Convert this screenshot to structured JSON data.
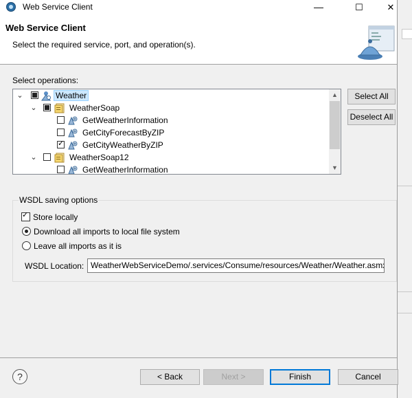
{
  "window": {
    "title": "Web Service Client",
    "minimize": "—",
    "maximize": "☐",
    "close": "✕"
  },
  "header": {
    "title": "Web Service Client",
    "description": "Select the required service, port, and operation(s)."
  },
  "operations": {
    "label": "Select operations:",
    "tree": [
      {
        "label": "Weather",
        "state": "partial",
        "expander": "⌄",
        "icon": "service-icon"
      },
      {
        "label": "WeatherSoap",
        "state": "partial",
        "expander": "⌄",
        "icon": "port-icon"
      },
      {
        "label": "GetWeatherInformation",
        "state": "unchecked",
        "icon": "operation-icon"
      },
      {
        "label": "GetCityForecastByZIP",
        "state": "unchecked",
        "icon": "operation-icon"
      },
      {
        "label": "GetCityWeatherByZIP",
        "state": "checked",
        "icon": "operation-icon"
      },
      {
        "label": "WeatherSoap12",
        "state": "unchecked",
        "expander": "⌄",
        "icon": "port-icon"
      },
      {
        "label": "GetWeatherInformation",
        "state": "unchecked",
        "icon": "operation-icon"
      }
    ],
    "select_all": "Select All",
    "deselect_all": "Deselect All"
  },
  "wsdl": {
    "group_title": "WSDL saving options",
    "store_locally": "Store locally",
    "store_locally_checked": true,
    "download_imports": "Download all imports to local file system",
    "leave_imports": "Leave all imports as it is",
    "selected_option": "download_imports",
    "location_label": "WSDL Location:",
    "location_value": "WeatherWebServiceDemo/.services/Consume/resources/Weather/Weather.asmx"
  },
  "footer": {
    "help": "?",
    "back": "< Back",
    "next": "Next >",
    "finish": "Finish",
    "cancel": "Cancel"
  },
  "colors": {
    "accent": "#0078d7",
    "selection": "#cce8ff"
  }
}
